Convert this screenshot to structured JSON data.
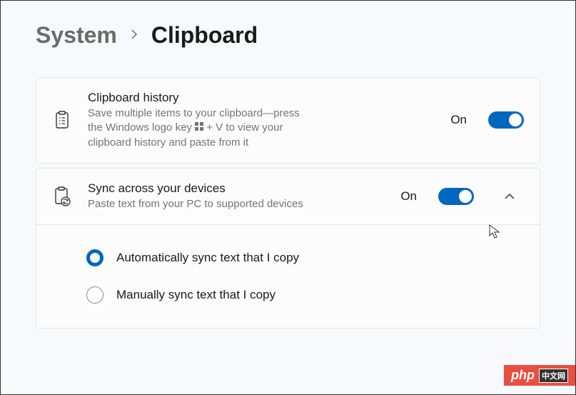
{
  "breadcrumb": {
    "parent": "System",
    "current": "Clipboard"
  },
  "settings": {
    "history": {
      "title": "Clipboard history",
      "description_before": "Save multiple items to your clipboard—press the Windows logo key ",
      "description_after": " + V to view your clipboard history and paste from it",
      "state": "On"
    },
    "sync": {
      "title": "Sync across your devices",
      "description": "Paste text from your PC to supported devices",
      "state": "On",
      "options": {
        "auto": "Automatically sync text that I copy",
        "manual": "Manually sync text that I copy"
      }
    }
  },
  "watermark": "php"
}
